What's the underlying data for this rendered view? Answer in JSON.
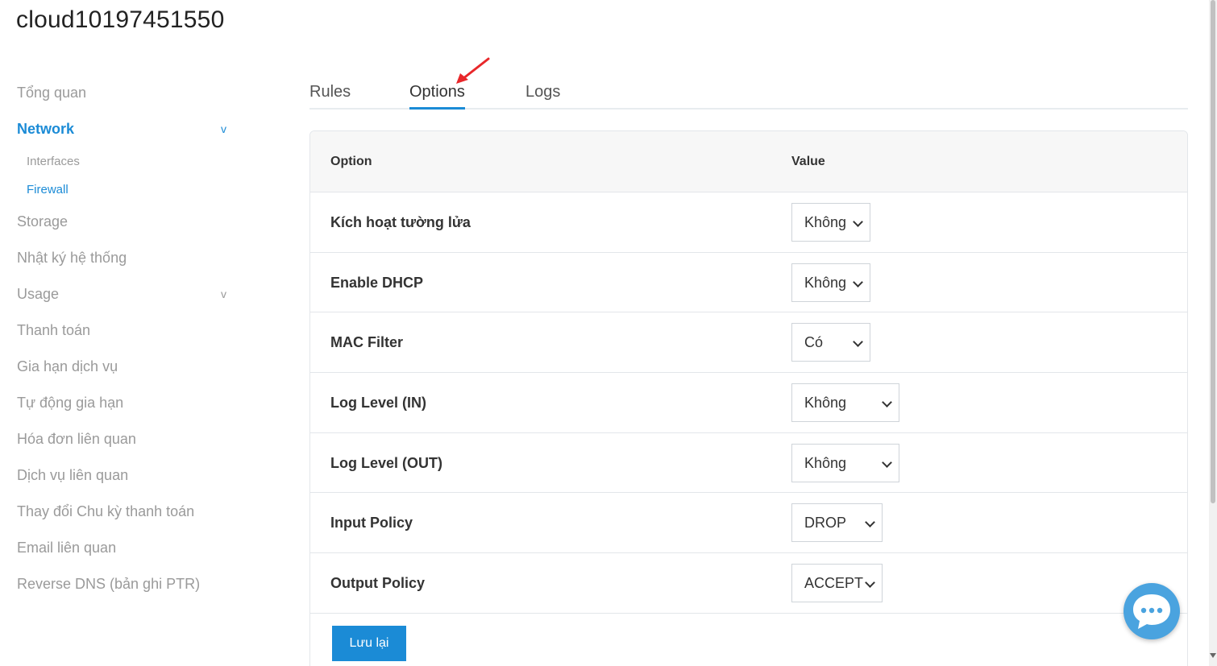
{
  "page_title": "cloud10197451550",
  "sidebar": {
    "items": [
      {
        "label": "Tổng quan"
      },
      {
        "label": "Network",
        "chevron": "v",
        "sub": [
          {
            "label": "Interfaces"
          },
          {
            "label": "Firewall"
          }
        ]
      },
      {
        "label": "Storage"
      },
      {
        "label": "Nhật ký hệ thống"
      },
      {
        "label": "Usage",
        "chevron": "v"
      },
      {
        "label": "Thanh toán"
      },
      {
        "label": "Gia hạn dịch vụ"
      },
      {
        "label": "Tự động gia hạn"
      },
      {
        "label": "Hóa đơn liên quan"
      },
      {
        "label": "Dịch vụ liên quan"
      },
      {
        "label": "Thay đổi Chu kỳ thanh toán"
      },
      {
        "label": "Email liên quan"
      },
      {
        "label": "Reverse DNS (bản ghi PTR)"
      }
    ]
  },
  "tabs": [
    {
      "label": "Rules"
    },
    {
      "label": "Options",
      "active": true
    },
    {
      "label": "Logs"
    }
  ],
  "table": {
    "headers": {
      "option": "Option",
      "value": "Value"
    },
    "rows": [
      {
        "label": "Kích hoạt tường lửa",
        "value": "Không"
      },
      {
        "label": "Enable DHCP",
        "value": "Không"
      },
      {
        "label": "MAC Filter",
        "value": "Có"
      },
      {
        "label": "Log Level (IN)",
        "value": "Không"
      },
      {
        "label": "Log Level (OUT)",
        "value": "Không"
      },
      {
        "label": "Input Policy",
        "value": "DROP"
      },
      {
        "label": "Output Policy",
        "value": "ACCEPT"
      }
    ]
  },
  "save_button": "Lưu lại",
  "colors": {
    "accent": "#1b8bd6",
    "annotation_arrow": "#e8272a",
    "chat_bubble": "#4aa3df"
  },
  "icons": {
    "chat": "chat-bubble-icon",
    "caret": "chevron-down-icon"
  }
}
